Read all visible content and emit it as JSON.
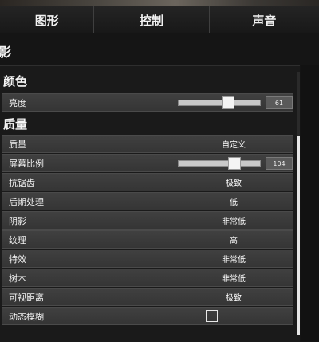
{
  "tabs": [
    {
      "label": "图形"
    },
    {
      "label": "控制"
    },
    {
      "label": "声音"
    }
  ],
  "page_title_partial": "影",
  "sections": {
    "color": {
      "title": "颜色",
      "brightness": {
        "label": "亮度",
        "value_text": "61",
        "percent": 61
      }
    },
    "quality": {
      "title": "质量",
      "rows": [
        {
          "label": "质量",
          "value": "自定义"
        },
        {
          "label": "屏幕比例",
          "value_text": "104",
          "percent": 69
        },
        {
          "label": "抗锯齿",
          "value": "极致"
        },
        {
          "label": "后期处理",
          "value": "低"
        },
        {
          "label": "阴影",
          "value": "非常低"
        },
        {
          "label": "纹理",
          "value": "高"
        },
        {
          "label": "特效",
          "value": "非常低"
        },
        {
          "label": "树木",
          "value": "非常低"
        },
        {
          "label": "可视距离",
          "value": "极致"
        },
        {
          "label": "动态模糊",
          "checked": false
        }
      ]
    }
  },
  "scrollbar": {
    "position_fraction": 0.25
  }
}
